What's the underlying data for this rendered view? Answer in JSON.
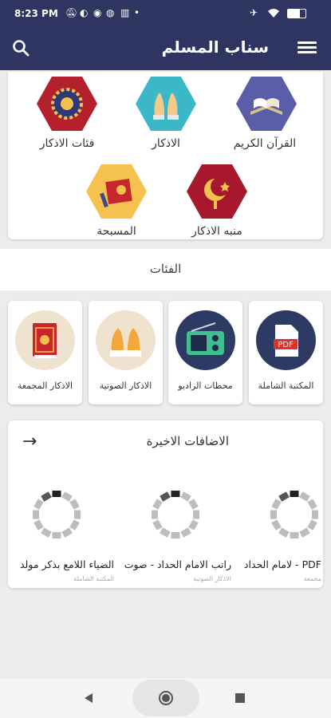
{
  "status": {
    "time": "8:23 PM"
  },
  "appbar": {
    "title": "سناب المسلم",
    "menu_icon": "hamburger-menu-icon",
    "search_icon": "search-icon"
  },
  "grid": [
    {
      "label": "القرآن الكريم",
      "icon": "quran-book-icon",
      "color": "#5a5ea8"
    },
    {
      "label": "الاذكار",
      "icon": "praying-hands-icon",
      "color": "#3bb8c8"
    },
    {
      "label": "فئات الاذكار",
      "icon": "rosette-icon",
      "color": "#b5202d"
    },
    {
      "label": "منبه الاذكار",
      "icon": "crescent-star-icon",
      "color": "#a7182e"
    },
    {
      "label": "المسبحة",
      "icon": "prayer-beads-icon",
      "color": "#f6c24f"
    }
  ],
  "categories_header": "الفئات",
  "categories": [
    {
      "label": "المكتبة الشاملة",
      "icon": "pdf-file-icon",
      "color": "#2d3a63"
    },
    {
      "label": "محطات الراديو",
      "icon": "radio-icon",
      "color": "#2d3a63"
    },
    {
      "label": "الاذكار الصوتية",
      "icon": "praying-hands-icon",
      "color": "#efe3cf"
    },
    {
      "label": "الاذكار المجمعة",
      "icon": "book-icon",
      "color": "#efe3cf"
    }
  ],
  "recent": {
    "title": "الاضافات الاخيرة",
    "arrow_icon": "arrow-right-icon",
    "items": [
      {
        "title": "PDF - لامام الحداد",
        "subtitle": "مجمعة"
      },
      {
        "title": "راتب الامام الحداد - صوت",
        "subtitle": "الاذكار الصوتية"
      },
      {
        "title": "الضياء اللامع بذكر مولد",
        "subtitle": "المكتبة الشاملة"
      }
    ]
  },
  "navbar": {
    "back_icon": "back-triangle-icon",
    "home_icon": "home-circle-icon",
    "recents_icon": "recents-square-icon"
  }
}
